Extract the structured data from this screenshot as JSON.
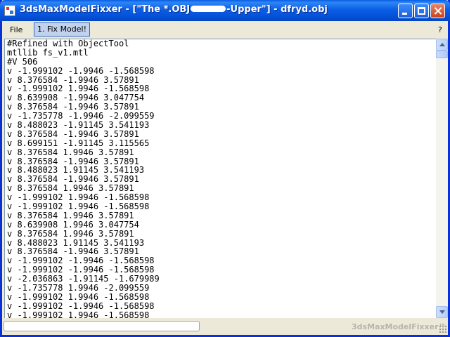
{
  "window": {
    "title_prefix": "3dsMaxModelFixxer - [\"The *.OBJ",
    "title_suffix": "-Upper\"] - dfryd.obj"
  },
  "menu": {
    "file_label": "File",
    "fix_model_label": "1. Fix Model!",
    "help_label": "?"
  },
  "editor": {
    "lines": [
      "#Refined with ObjectTool",
      "mtllib fs_v1.mtl",
      "#V 506",
      "v -1.999102 -1.9946 -1.568598",
      "v 8.376584 -1.9946 3.57891",
      "v -1.999102 1.9946 -1.568598",
      "v 8.639908 -1.9946 3.047754",
      "v 8.376584 -1.9946 3.57891",
      "v -1.735778 -1.9946 -2.099559",
      "v 8.488023 -1.91145 3.541193",
      "v 8.376584 -1.9946 3.57891",
      "v 8.699151 -1.91145 3.115565",
      "v 8.376584 1.9946 3.57891",
      "v 8.376584 -1.9946 3.57891",
      "v 8.488023 1.91145 3.541193",
      "v 8.376584 -1.9946 3.57891",
      "v 8.376584 1.9946 3.57891",
      "v -1.999102 1.9946 -1.568598",
      "v -1.999102 1.9946 -1.568598",
      "v 8.376584 1.9946 3.57891",
      "v 8.639908 1.9946 3.047754",
      "v 8.376584 1.9946 3.57891",
      "v 8.488023 1.91145 3.541193",
      "v 8.376584 -1.9946 3.57891",
      "v -1.999102 -1.9946 -1.568598",
      "v -1.999102 -1.9946 -1.568598",
      "v -2.036863 -1.91145 -1.679989",
      "v -1.735778 1.9946 -2.099559",
      "v -1.999102 1.9946 -1.568598",
      "v -1.999102 -1.9946 -1.568598",
      "v -1.999102 1.9946 -1.568598"
    ]
  },
  "status": {
    "progress_fraction": 0,
    "brand": "3dsMaxModelFixxer™"
  },
  "colors": {
    "titlebar": "#0a5fe3",
    "window_bg": "#ece9d8",
    "editor_bg": "#ffffff"
  }
}
